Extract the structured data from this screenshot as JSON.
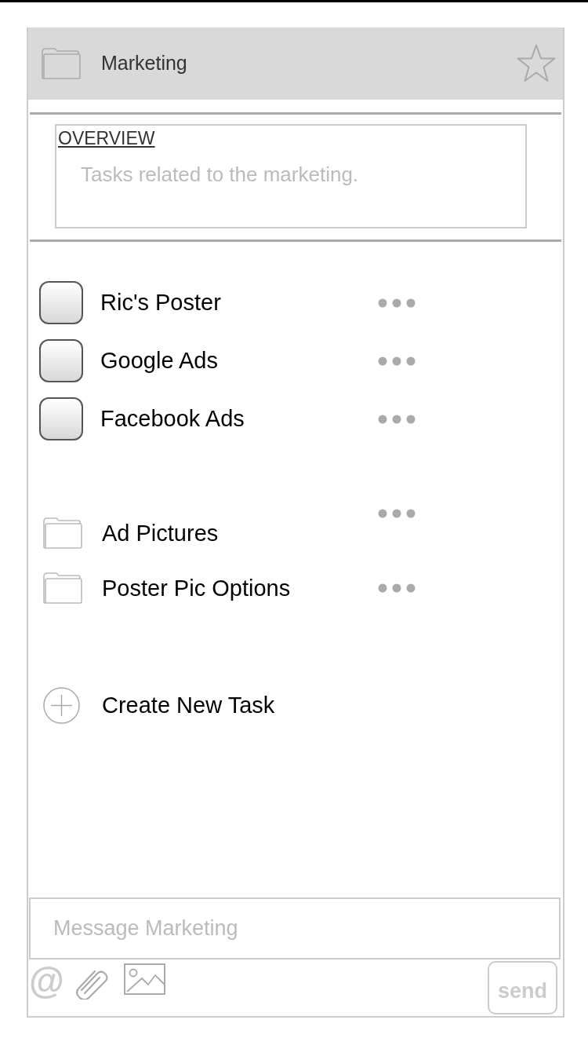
{
  "header": {
    "title": "Marketing",
    "starred": false
  },
  "overview": {
    "heading": "OVERVIEW",
    "description": "Tasks related to the marketing."
  },
  "tasks": [
    {
      "label": "Ric's Poster",
      "checked": false
    },
    {
      "label": "Google Ads",
      "checked": false
    },
    {
      "label": "Facebook Ads",
      "checked": false
    }
  ],
  "folders": [
    {
      "label": "Ad Pictures"
    },
    {
      "label": "Poster Pic Options"
    }
  ],
  "create_button": {
    "label": "Create New Task"
  },
  "composer": {
    "placeholder": "Message Marketing",
    "mention_symbol": "@",
    "send_label": "send"
  }
}
